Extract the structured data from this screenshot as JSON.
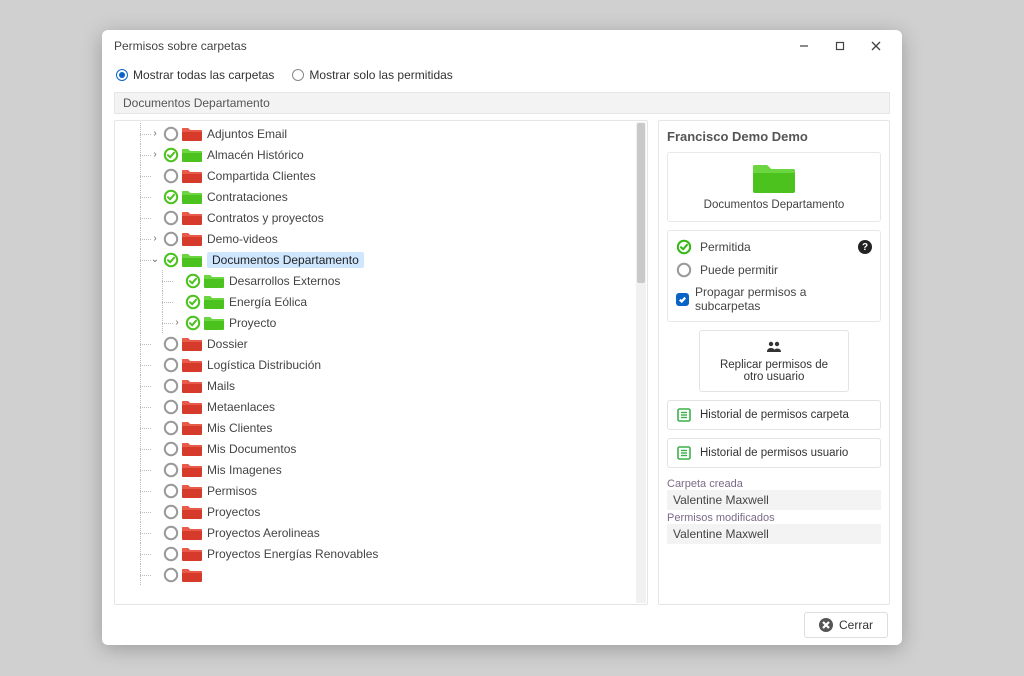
{
  "window": {
    "title": "Permisos sobre carpetas"
  },
  "filter": {
    "all": "Mostrar todas las carpetas",
    "permitted": "Mostrar solo las permitidas",
    "selected": "all"
  },
  "path": "Documentos Departamento",
  "tree": [
    {
      "level": 1,
      "perm": "none",
      "color": "red",
      "label": "Adjuntos Email",
      "exp": ">"
    },
    {
      "level": 1,
      "perm": "allow",
      "color": "green",
      "label": "Almacén Histórico",
      "exp": ">"
    },
    {
      "level": 1,
      "perm": "none",
      "color": "red",
      "label": "Compartida Clientes"
    },
    {
      "level": 1,
      "perm": "allow",
      "color": "green",
      "label": "Contrataciones"
    },
    {
      "level": 1,
      "perm": "none",
      "color": "red",
      "label": "Contratos y proyectos"
    },
    {
      "level": 1,
      "perm": "none",
      "color": "red",
      "label": "Demo-videos",
      "exp": ">"
    },
    {
      "level": 1,
      "perm": "allow",
      "color": "green",
      "label": "Documentos Departamento",
      "exp": "v",
      "selected": true
    },
    {
      "level": 2,
      "perm": "allow",
      "color": "green",
      "label": "Desarrollos Externos"
    },
    {
      "level": 2,
      "perm": "allow",
      "color": "green",
      "label": "Energía Eólica"
    },
    {
      "level": 2,
      "perm": "allow",
      "color": "green",
      "label": "Proyecto",
      "exp": ">"
    },
    {
      "level": 1,
      "perm": "none",
      "color": "red",
      "label": "Dossier"
    },
    {
      "level": 1,
      "perm": "none",
      "color": "red",
      "label": "Logística Distribución"
    },
    {
      "level": 1,
      "perm": "none",
      "color": "red",
      "label": "Mails"
    },
    {
      "level": 1,
      "perm": "none",
      "color": "red",
      "label": "Metaenlaces"
    },
    {
      "level": 1,
      "perm": "none",
      "color": "red",
      "label": "Mis Clientes"
    },
    {
      "level": 1,
      "perm": "none",
      "color": "red",
      "label": "Mis Documentos"
    },
    {
      "level": 1,
      "perm": "none",
      "color": "red",
      "label": "Mis Imagenes"
    },
    {
      "level": 1,
      "perm": "none",
      "color": "red",
      "label": "Permisos"
    },
    {
      "level": 1,
      "perm": "none",
      "color": "red",
      "label": "Proyectos"
    },
    {
      "level": 1,
      "perm": "none",
      "color": "red",
      "label": "Proyectos Aerolineas"
    },
    {
      "level": 1,
      "perm": "none",
      "color": "red",
      "label": "Proyectos Energías Renovables"
    },
    {
      "level": 1,
      "perm": "none",
      "color": "red",
      "label": ""
    }
  ],
  "detail": {
    "user": "Francisco Demo Demo",
    "folder": "Documentos Departamento",
    "permitted": "Permitida",
    "can_permit": "Puede permitir",
    "propagate": "Propagar permisos a subcarpetas",
    "propagate_checked": true,
    "replicate": "Replicar permisos de otro usuario",
    "history_folder": "Historial de permisos carpeta",
    "history_user": "Historial de permisos usuario",
    "created_label": "Carpeta creada",
    "created_by": "Valentine Maxwell",
    "modified_label": "Permisos modificados",
    "modified_by": "Valentine Maxwell"
  },
  "footer": {
    "close": "Cerrar"
  },
  "colors": {
    "green": "#4cc21e",
    "red": "#d63a2b",
    "accent": "#0a63c7"
  }
}
